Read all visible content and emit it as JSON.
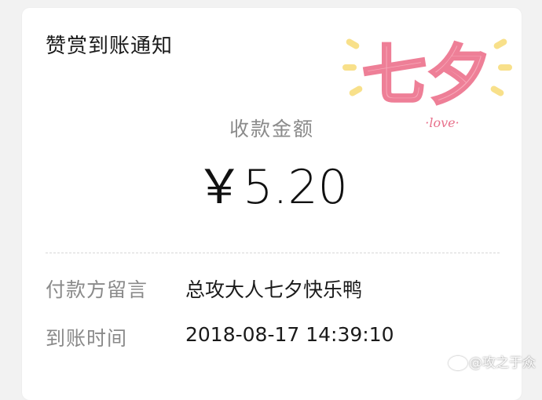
{
  "header": {
    "title": "赞赏到账通知"
  },
  "decoration": {
    "main_text": "七夕",
    "sub_text": "·love·"
  },
  "amount": {
    "label": "收款金额",
    "value": "￥5.20"
  },
  "details": [
    {
      "key": "付款方留言",
      "value": "总攻大人七夕快乐鸭"
    },
    {
      "key": "到账时间",
      "value": "2018-08-17 14:39:10"
    }
  ],
  "watermark": {
    "text": "@攻之于众"
  },
  "colors": {
    "background": "#f2f2f2",
    "card": "#ffffff",
    "title_text": "#1a1a1a",
    "label_text": "#8a8a8a",
    "decor_pink": "#f48aa0",
    "decor_yellow": "#f8e08a"
  }
}
